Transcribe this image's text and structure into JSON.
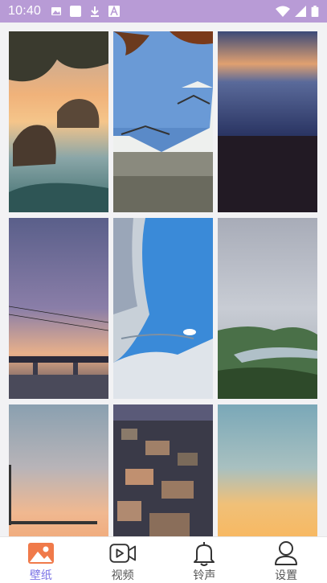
{
  "status_bar": {
    "time": "10:40",
    "left_icons": [
      "image-icon",
      "square-icon",
      "download-icon",
      "text-a-icon"
    ],
    "right_icons": [
      "wifi-icon",
      "signal-icon",
      "battery-icon"
    ],
    "background": "#b89bd6"
  },
  "wallpapers": [
    {
      "subject": "sunset-coast-rocks"
    },
    {
      "subject": "japanese-castle"
    },
    {
      "subject": "dusk-sea-horizon"
    },
    {
      "subject": "evening-sky-bridge"
    },
    {
      "subject": "anime-character-sky"
    },
    {
      "subject": "misty-river-valley"
    },
    {
      "subject": "sunset-pier"
    },
    {
      "subject": "hillside-town-dusk"
    },
    {
      "subject": "golden-clouds"
    }
  ],
  "tabs": [
    {
      "label": "壁纸",
      "icon": "image-icon",
      "active": true
    },
    {
      "label": "视频",
      "icon": "video-icon",
      "active": false
    },
    {
      "label": "铃声",
      "icon": "bell-icon",
      "active": false
    },
    {
      "label": "设置",
      "icon": "person-icon",
      "active": false
    }
  ],
  "colors": {
    "accent": "#7b73e6",
    "tab_active_icon": "#f07a4a"
  }
}
